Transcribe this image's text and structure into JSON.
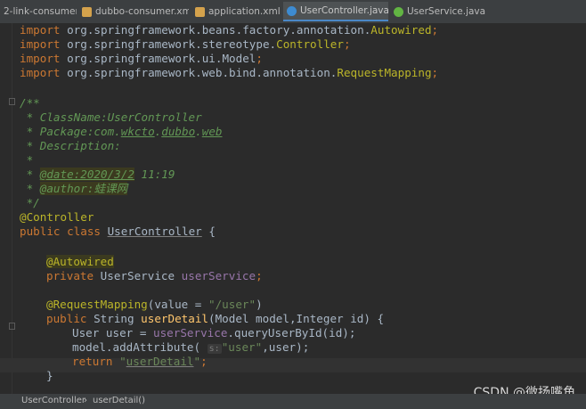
{
  "tabs": [
    {
      "label": "2-link-consumer",
      "icon": "module-icon"
    },
    {
      "label": "dubbo-consumer.xml",
      "icon": "xml-file-icon"
    },
    {
      "label": "application.xml",
      "icon": "xml-file-icon"
    },
    {
      "label": "UserController.java",
      "icon": "java-class-icon",
      "active": true
    },
    {
      "label": "UserService.java",
      "icon": "java-interface-icon"
    }
  ],
  "close_glyph": "×",
  "code": {
    "import_kw": "import",
    "imp1_pkg": " org.springframework.beans.factory.annotation.",
    "imp1_cls": "Autowired",
    "imp2_pkg": " org.springframework.stereotype.",
    "imp2_cls": "Controller",
    "imp3_pkg": " org.springframework.ui.Model",
    "imp4_pkg": " org.springframework.web.bind.annotation.",
    "imp4_cls": "RequestMapping",
    "semicolon": ";",
    "doc_open": "/**",
    "doc_classname": " * ClassName:UserController",
    "doc_pkg_prefix": " * Package:com.",
    "doc_pkg_a": "wkcto",
    "doc_dot": ".",
    "doc_pkg_b": "dubbo",
    "doc_pkg_c": "web",
    "doc_desc": " * Description:",
    "doc_star": " *",
    "doc_star_sp": " * ",
    "doc_date_tag": "@date:2020/3/2",
    "doc_date_time": " 11:19",
    "doc_author_tag": "@author:",
    "doc_author_name": "蛙课网",
    "doc_close": " */",
    "ann_controller": "@Controller",
    "class_kw": "public class ",
    "class_name": "UserController",
    "class_open": " {",
    "ann_autowired": "@Autowired",
    "field_kw": "private ",
    "field_type": "UserService ",
    "field_name": "userService",
    "ann_rm": "@RequestMapping",
    "rm_args_a": "(value = ",
    "rm_value": "\"/user\"",
    "rm_args_b": ")",
    "method_kw": "public ",
    "method_ret": "String ",
    "method_name": "userDetail",
    "method_params": "(Model model,Integer id) {",
    "stmt1_a": "User user = ",
    "stmt1_field": "userService",
    "stmt1_b": ".queryUserById(id);",
    "stmt2_a": "model.addAttribute( ",
    "stmt2_hint": "s:",
    "stmt2_str": "\"user\"",
    "stmt2_b": ",user);",
    "return_kw": "return ",
    "return_q1": "\"",
    "return_val": "userDetail",
    "return_q2": "\"",
    "close_brace": "}"
  },
  "breadcrumb": {
    "item1": "UserController",
    "sep": "›",
    "item2": "userDetail()"
  },
  "watermark": "CSDN @微扬嘴角"
}
